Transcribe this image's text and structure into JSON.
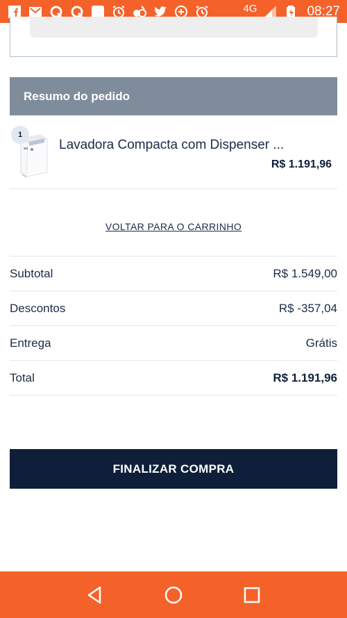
{
  "status_bar": {
    "network": "4G",
    "time": "08:27",
    "icons": [
      "facebook-icon",
      "gmail-icon",
      "quora-icon",
      "quora-icon",
      "app-icon",
      "alarm-icon",
      "app-icon",
      "twitter-icon",
      "add-circle-icon",
      "alarm-icon",
      "signal-icon",
      "battery-icon"
    ]
  },
  "order_summary": {
    "title": "Resumo do pedido",
    "items": [
      {
        "quantity": "1",
        "name": "Lavadora Compacta com Dispenser ...",
        "price": "R$ 1.191,96"
      }
    ]
  },
  "back_to_cart": "VOLTAR PARA O CARRINHO",
  "totals": {
    "subtotal_label": "Subtotal",
    "subtotal_value": "R$ 1.549,00",
    "discounts_label": "Descontos",
    "discounts_value": "R$ -357,04",
    "delivery_label": "Entrega",
    "delivery_value": "Grátis",
    "total_label": "Total",
    "total_value": "R$ 1.191,96"
  },
  "finalize_button": "FINALIZAR COMPRA",
  "nav_bar": {
    "icons": [
      "back-icon",
      "home-icon",
      "recents-icon"
    ]
  },
  "colors": {
    "accent": "#f4622a",
    "header": "#7f8c9b",
    "primary_button": "#0f1f3a"
  }
}
